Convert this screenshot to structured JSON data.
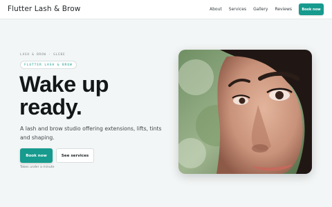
{
  "header": {
    "brand": "Flutter Lash & Brow",
    "nav": [
      "About",
      "Services",
      "Gallery",
      "Reviews"
    ],
    "cta_label": "Book now"
  },
  "hero": {
    "eyebrow": "LASH & BROW · GLEBE",
    "chip": "FLUTTER LASH & BROW",
    "title_line1": "Wake up",
    "title_line2": "ready.",
    "subtitle": "A lash and brow studio offering extensions, lifts, tints and shaping.",
    "primary_cta": "Book now",
    "secondary_cta": "See services",
    "note": "Takes under a minute"
  },
  "colors": {
    "accent": "#169b8e",
    "background": "#f3f6f6",
    "text": "#141718"
  }
}
